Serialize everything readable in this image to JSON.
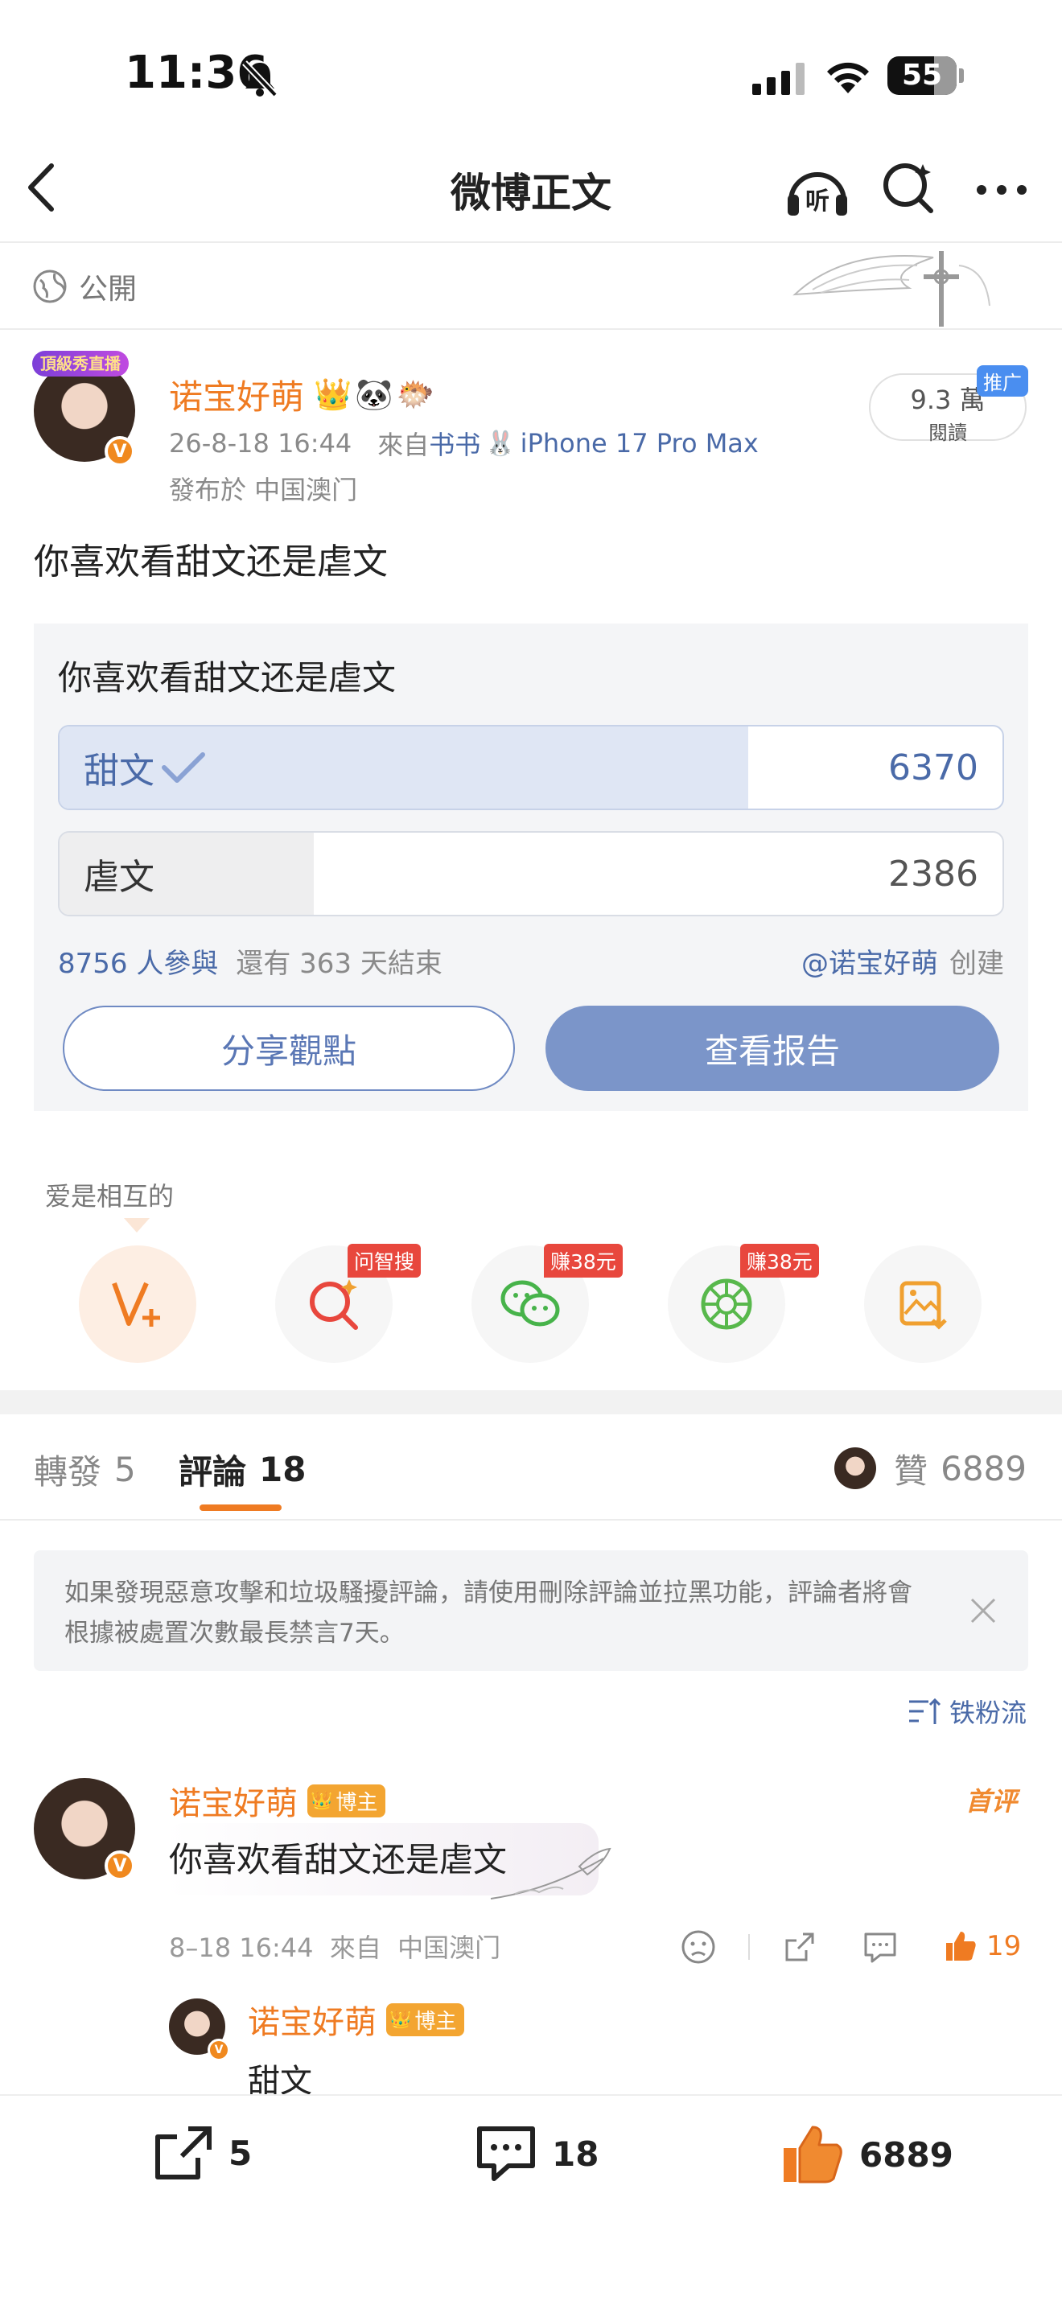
{
  "status_bar": {
    "time": "11:36",
    "battery": "55"
  },
  "nav": {
    "title": "微博正文"
  },
  "visibility": {
    "label": "公開"
  },
  "post": {
    "author": "诺宝好萌",
    "author_tag": "頂級秀直播",
    "date": "26-8-18 16:44",
    "from_prefix": "來自",
    "source_app": "书书",
    "device": "iPhone 17 Pro Max",
    "location": "發布於 中国澳门",
    "read_count": "9.3 萬",
    "read_label": "閱讀",
    "promo_tag": "推广",
    "text": "你喜欢看甜文还是虐文"
  },
  "poll": {
    "question": "你喜欢看甜文还是虐文",
    "options": [
      {
        "label": "甜文",
        "count": "6370",
        "selected": true,
        "fill": 0.73
      },
      {
        "label": "虐文",
        "count": "2386",
        "selected": false,
        "fill": 0.27
      }
    ],
    "participants": "8756 人參與",
    "remaining": "還有 363 天結束",
    "creator": "@诺宝好萌",
    "creator_suffix": "创建",
    "share_button": "分享觀點",
    "report_button": "查看报告"
  },
  "action_row": {
    "caption": "爱是相互的",
    "items": [
      {
        "icon": "vplus-icon",
        "badge": ""
      },
      {
        "icon": "ai-search-icon",
        "badge": "问智搜"
      },
      {
        "icon": "wechat-icon",
        "badge": "赚38元"
      },
      {
        "icon": "moments-icon",
        "badge": "赚38元"
      },
      {
        "icon": "save-image-icon",
        "badge": ""
      }
    ]
  },
  "tabs": {
    "repost": {
      "label": "轉發",
      "count": "5"
    },
    "comment": {
      "label": "評論",
      "count": "18"
    },
    "like": {
      "label": "贊",
      "count": "6889"
    }
  },
  "notice": {
    "text": "如果發現惡意攻擊和垃圾騷擾評論，請使用刪除評論並拉黑功能，評論者將會根據被處置次數最長禁言7天。"
  },
  "sort": {
    "label": "铁粉流"
  },
  "comment": {
    "author": "诺宝好萌",
    "host_tag": "博主",
    "first_tag": "首评",
    "text": "你喜欢看甜文还是虐文",
    "meta": "8–18 16:44  來自  中国澳门",
    "likes": "19",
    "reply": {
      "author": "诺宝好萌",
      "host_tag": "博主",
      "text": "甜文"
    }
  },
  "bottom_bar": {
    "repost_count": "5",
    "comment_count": "18",
    "like_count": "6889"
  },
  "colors": {
    "accent": "#ef7b22",
    "link": "#4a6aa8",
    "poll_selected": "#dfe6f4",
    "report_button": "#7b95c9"
  }
}
